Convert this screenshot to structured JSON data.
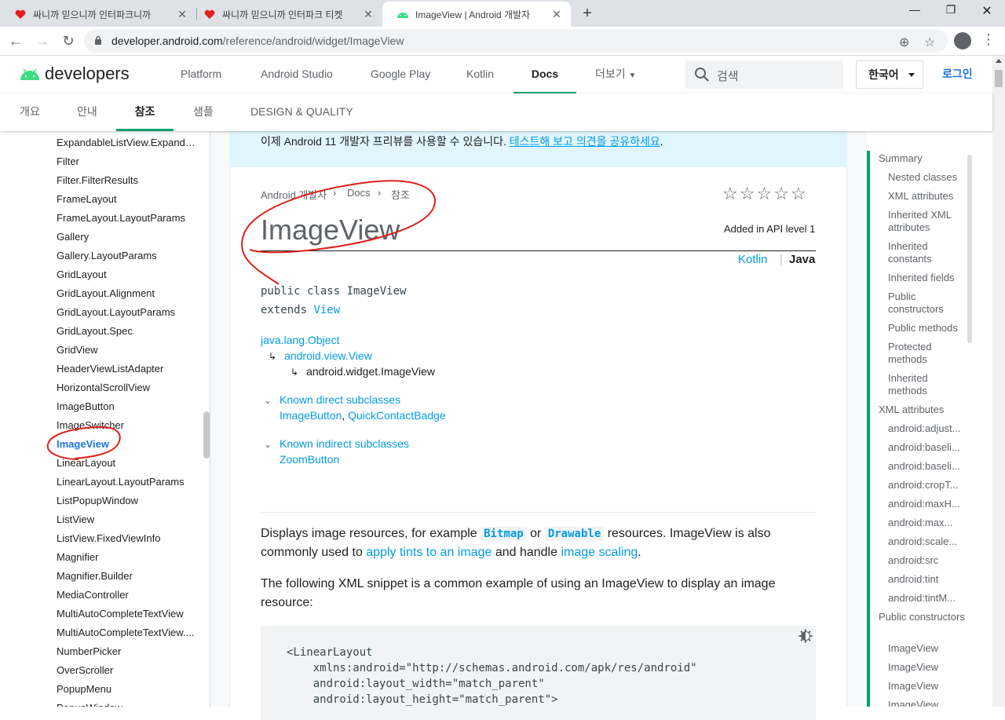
{
  "browser": {
    "tabs": [
      {
        "title": "싸니까 믿으니까 인터파크니까"
      },
      {
        "title": "싸니까 믿으니까 인터파크 티켓"
      },
      {
        "title": "ImageView  |  Android 개발자"
      }
    ],
    "url_host": "developer.android.com",
    "url_path": "/reference/android/widget/ImageView"
  },
  "site": {
    "logo_text": "developers",
    "nav": [
      "Platform",
      "Android Studio",
      "Google Play",
      "Kotlin",
      "Docs",
      "더보기"
    ],
    "search_placeholder": "검색",
    "language": "한국어",
    "login": "로그인",
    "subnav": [
      "개요",
      "안내",
      "참조",
      "샘플",
      "DESIGN & QUALITY"
    ]
  },
  "leftnav": {
    "items": [
      "ExpandableListView.Expanda...",
      "Filter",
      "Filter.FilterResults",
      "FrameLayout",
      "FrameLayout.LayoutParams",
      "Gallery",
      "Gallery.LayoutParams",
      "GridLayout",
      "GridLayout.Alignment",
      "GridLayout.LayoutParams",
      "GridLayout.Spec",
      "GridView",
      "HeaderViewListAdapter",
      "HorizontalScrollView",
      "ImageButton",
      "ImageSwitcher",
      "ImageView",
      "LinearLayout",
      "LinearLayout.LayoutParams",
      "ListPopupWindow",
      "ListView",
      "ListView.FixedViewInfo",
      "Magnifier",
      "Magnifier.Builder",
      "MediaController",
      "MultiAutoCompleteTextView",
      "MultiAutoCompleteTextView....",
      "NumberPicker",
      "OverScroller",
      "PopupMenu",
      "PopupWindow"
    ],
    "active_index": 16
  },
  "banner": {
    "text": "이제 Android 11 개발자 프리뷰를 사용할 수 있습니다. ",
    "link": "테스트해 보고 의견을 공유하세요",
    "tail": "."
  },
  "page": {
    "breadcrumb": [
      "Android 개발자",
      "Docs",
      "참조"
    ],
    "title": "ImageView",
    "api_level": "Added in API level 1",
    "lang_kotlin": "Kotlin",
    "lang_java": "Java",
    "decl_line1": "public class ImageView",
    "decl_extends": "extends ",
    "decl_parent": "View",
    "hierarchy": [
      "java.lang.Object",
      "android.view.View",
      "android.widget.ImageView"
    ],
    "direct_head": "Known direct subclasses",
    "direct_list": [
      "ImageButton",
      "QuickContactBadge"
    ],
    "indirect_head": "Known indirect subclasses",
    "indirect_list": [
      "ZoomButton"
    ],
    "p1_a": "Displays image resources, for example ",
    "p1_code1": "Bitmap",
    "p1_b": " or ",
    "p1_code2": "Drawable",
    "p1_c": " resources. ImageView is also commonly used to ",
    "p1_link1": "apply tints to an image",
    "p1_d": " and handle ",
    "p1_link2": "image scaling",
    "p1_e": ".",
    "p2": "The following XML snippet is a common example of using an ImageView to display an image resource:",
    "code": "<LinearLayout\n    xmlns:android=\"http://schemas.android.com/apk/res/android\"\n    android:layout_width=\"match_parent\"\n    android:layout_height=\"match_parent\">"
  },
  "toc": [
    "Summary",
    "Nested classes",
    "XML attributes",
    "Inherited XML attributes",
    "Inherited constants",
    "Inherited fields",
    "Public constructors",
    "Public methods",
    "Protected methods",
    "Inherited methods",
    "XML attributes",
    "android:adjust...",
    "android:baseli...",
    "android:baseli...",
    "android:cropT...",
    "android:maxH...",
    "android:max...",
    "android:scale...",
    "android:src",
    "android:tint",
    "android:tintM...",
    "Public constructors",
    "ImageView",
    "ImageView",
    "ImageView",
    "ImageView"
  ],
  "colors": {
    "accent_green": "#00a36b",
    "link_blue": "#039be5",
    "annotation_red": "#e0201b"
  }
}
